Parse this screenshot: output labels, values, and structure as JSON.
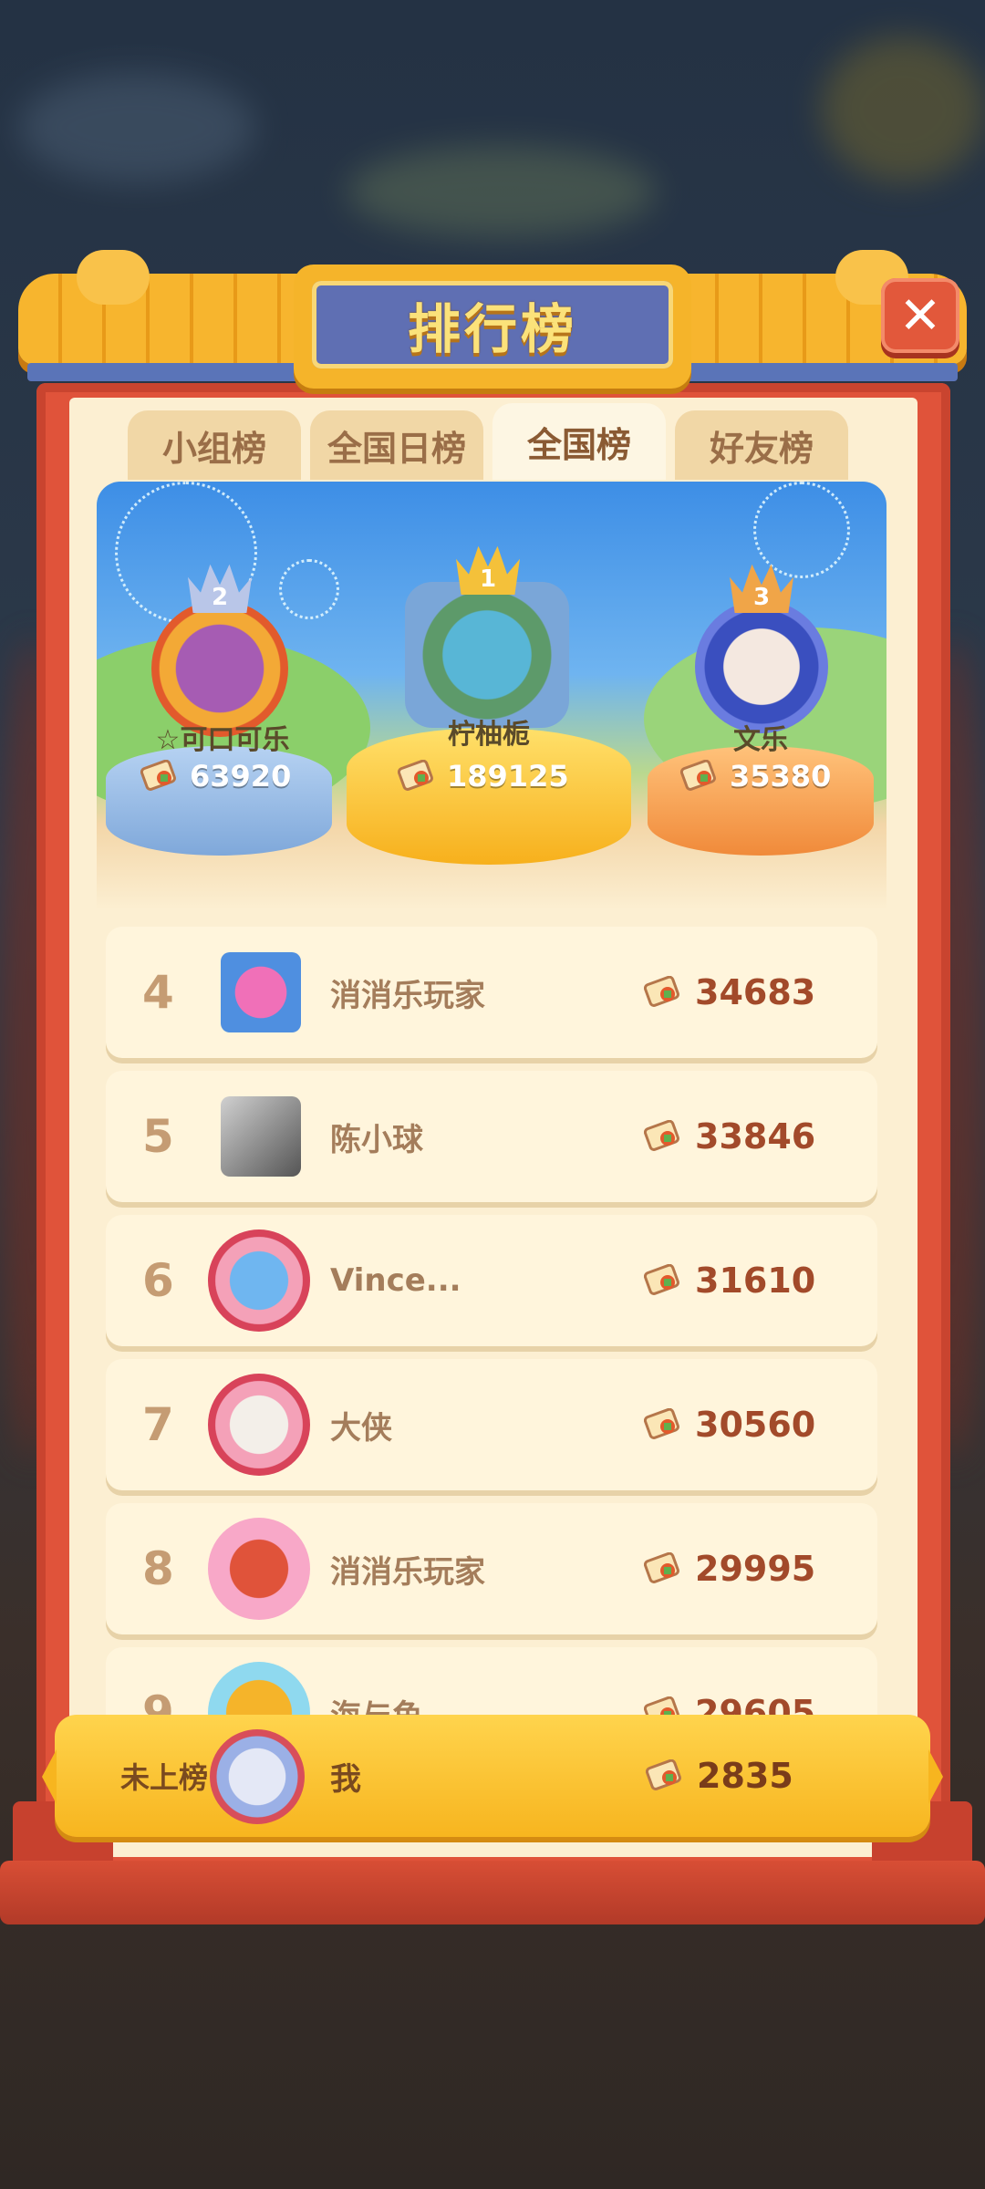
{
  "title": "排行榜",
  "close_label": "✕",
  "tabs": [
    {
      "label": "小组榜",
      "active": false
    },
    {
      "label": "全国日榜",
      "active": false
    },
    {
      "label": "全国榜",
      "active": true
    },
    {
      "label": "好友榜",
      "active": false
    }
  ],
  "podium": {
    "first": {
      "rank": "1",
      "name": "柠柚栀",
      "score": "189125"
    },
    "second": {
      "rank": "2",
      "name": "☆可口可乐",
      "score": "63920"
    },
    "third": {
      "rank": "3",
      "name": "文乐",
      "score": "35380"
    }
  },
  "list": [
    {
      "rank": "4",
      "name": "消消乐玩家",
      "score": "34683"
    },
    {
      "rank": "5",
      "name": "陈小球",
      "score": "33846"
    },
    {
      "rank": "6",
      "name": "Vince...",
      "score": "31610"
    },
    {
      "rank": "7",
      "name": "大侠",
      "score": "30560"
    },
    {
      "rank": "8",
      "name": "消消乐玩家",
      "score": "29995"
    },
    {
      "rank": "9",
      "name": "海与鱼",
      "score": "29605"
    }
  ],
  "me": {
    "rank_label": "未上榜",
    "name": "我",
    "score": "2835"
  },
  "colors": {
    "frame": "#e0533a",
    "roof": "#f7b52e",
    "plaque": "#5f6fb3",
    "gold": "#f7b51f"
  }
}
